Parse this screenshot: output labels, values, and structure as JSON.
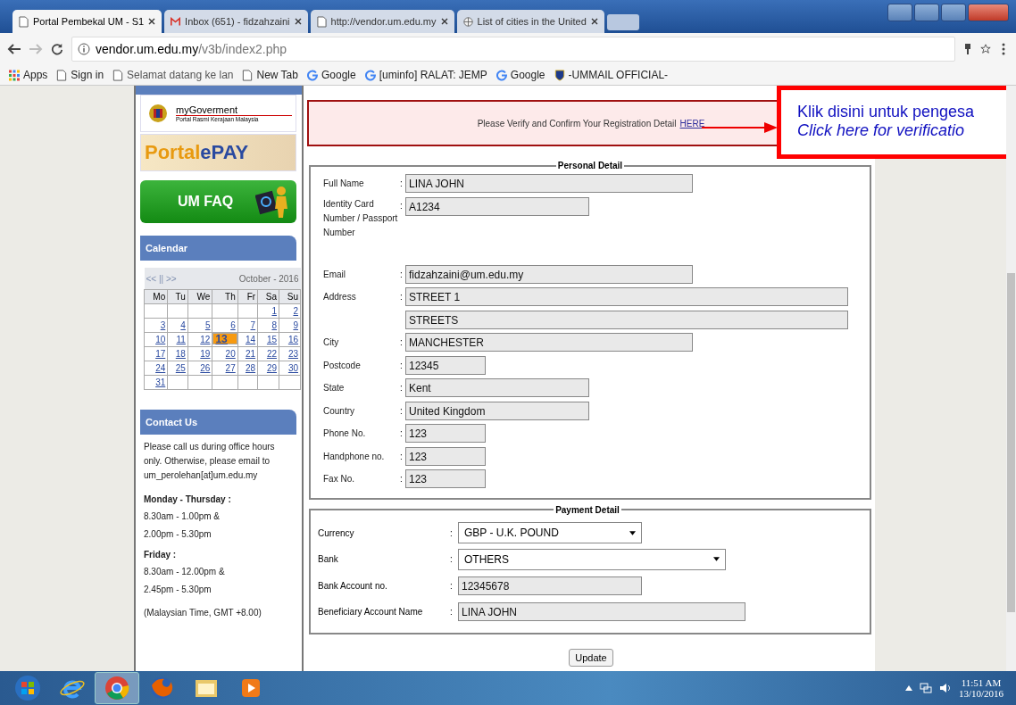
{
  "browser": {
    "tabs": [
      {
        "title": "Portal Pembekal UM - S1",
        "kind": "page",
        "selected": true
      },
      {
        "title": "Inbox (651) - fidzahzaini",
        "kind": "mail",
        "selected": false
      },
      {
        "title": "http://vendor.um.edu.my",
        "kind": "page",
        "selected": false
      },
      {
        "title": "List of cities in the United",
        "kind": "wiki",
        "selected": false
      }
    ],
    "address": {
      "host": "vendor.um.edu.my",
      "path": "/v3b/index2.php"
    },
    "bookmarks": [
      {
        "label": "Apps",
        "kind": "apps"
      },
      {
        "label": "Sign in",
        "kind": "page"
      },
      {
        "label": "Selamat datang ke lan",
        "kind": "page"
      },
      {
        "label": "New Tab",
        "kind": "page"
      },
      {
        "label": "Google",
        "kind": "google"
      },
      {
        "label": "[uminfo] RALAT: JEMP",
        "kind": "google"
      },
      {
        "label": "Google",
        "kind": "google"
      },
      {
        "label": "-UMMAIL OFFICIAL-",
        "kind": "shield"
      }
    ]
  },
  "sidebar": {
    "mygov": {
      "title": "myGoverment",
      "subtitle": "Portal Rasmi Kerajaan Malaysia"
    },
    "epay": {
      "part1": "Portal",
      "part2": "ePAY"
    },
    "faq": "UM FAQ",
    "calendar": {
      "title": "Calendar",
      "nav": "<< || >>",
      "month": "October - 2016",
      "weekdays": [
        "Mo",
        "Tu",
        "We",
        "Th",
        "Fr",
        "Sa",
        "Su"
      ],
      "weeks": [
        [
          {
            "day": "1",
            "selected": false
          },
          {
            "day": "2",
            "selected": false
          }
        ],
        [
          {
            "day": "3",
            "selected": false
          },
          {
            "day": "4",
            "selected": false
          },
          {
            "day": "5",
            "selected": false
          },
          {
            "day": "6",
            "selected": false
          },
          {
            "day": "7",
            "selected": false
          },
          {
            "day": "8",
            "selected": false
          },
          {
            "day": "9",
            "selected": false
          }
        ],
        [
          {
            "day": "10",
            "selected": false
          },
          {
            "day": "11",
            "selected": false
          },
          {
            "day": "12",
            "selected": false
          },
          {
            "day": "13",
            "selected": true
          },
          {
            "day": "14",
            "selected": false
          },
          {
            "day": "15",
            "selected": false
          },
          {
            "day": "16",
            "selected": false
          }
        ],
        [
          {
            "day": "17",
            "selected": false
          },
          {
            "day": "18",
            "selected": false
          },
          {
            "day": "19",
            "selected": false
          },
          {
            "day": "20",
            "selected": false
          },
          {
            "day": "21",
            "selected": false
          },
          {
            "day": "22",
            "selected": false
          },
          {
            "day": "23",
            "selected": false
          }
        ],
        [
          {
            "day": "24",
            "selected": false
          },
          {
            "day": "25",
            "selected": false
          },
          {
            "day": "26",
            "selected": false
          },
          {
            "day": "27",
            "selected": false
          },
          {
            "day": "28",
            "selected": false
          },
          {
            "day": "29",
            "selected": false
          },
          {
            "day": "30",
            "selected": false
          }
        ],
        [
          {
            "day": "31",
            "selected": false
          }
        ]
      ]
    },
    "contact": {
      "title": "Contact Us",
      "intro": "Please call us during office hours only. Otherwise, please email to um_perolehan[at]um.edu.my",
      "schedule": [
        {
          "heading": "Monday - Thursday :",
          "lines": [
            "8.30am - 1.00pm &",
            "2.00pm - 5.30pm"
          ]
        },
        {
          "heading": "Friday :",
          "lines": [
            "8.30am - 12.00pm &",
            "2.45pm - 5.30pm"
          ]
        }
      ],
      "note": "(Malaysian Time, GMT +8.00)"
    }
  },
  "notice": {
    "text": "Please Verify and Confirm Your Registration Detail",
    "link": "HERE"
  },
  "callout": {
    "line1": "Klik disini untuk pengesa",
    "line2": "Click here for verificatio"
  },
  "personal": {
    "legend": "Personal Detail",
    "fields": [
      {
        "label": "Full Name",
        "colon": ":",
        "value": "LINA JOHN",
        "kind": "long"
      },
      {
        "label": "Identity Card Number / Passport Number",
        "colon": ":",
        "value": "A1234",
        "kind": "medium"
      },
      {
        "label": "Email",
        "colon": ":",
        "value": "fidzahzaini@um.edu.my",
        "kind": "long"
      },
      {
        "label": "Address",
        "colon": ":",
        "value": "STREET 1",
        "kind": "wide"
      },
      {
        "value": "STREETS",
        "kind": "wide"
      },
      {
        "label": "City",
        "colon": ":",
        "value": "MANCHESTER",
        "kind": "long"
      },
      {
        "label": "Postcode",
        "colon": ":",
        "value": "12345",
        "kind": "short"
      },
      {
        "label": "State",
        "colon": ":",
        "value": "Kent",
        "kind": "medium"
      },
      {
        "label": "Country",
        "colon": ":",
        "value": "United Kingdom",
        "kind": "medium"
      },
      {
        "label": "Phone No.",
        "colon": ":",
        "value": "123",
        "kind": "short"
      },
      {
        "label": "Handphone no.",
        "colon": ":",
        "value": "123",
        "kind": "short"
      },
      {
        "label": "Fax No.",
        "colon": ":",
        "value": "123",
        "kind": "short"
      }
    ]
  },
  "payment": {
    "legend": "Payment Detail",
    "fields": [
      {
        "label": "Currency",
        "colon": ":",
        "value": "GBP - U.K. POUND",
        "kind": "select_medium"
      },
      {
        "label": "Bank",
        "colon": ":",
        "value": "OTHERS",
        "kind": "select_long"
      },
      {
        "label": "Bank Account no.",
        "colon": ":",
        "value": "12345678",
        "kind": "text_medium"
      },
      {
        "label": "Beneficiary Account Name",
        "colon": ":",
        "value": "LINA JOHN",
        "kind": "text_long"
      }
    ]
  },
  "update_button": "Update",
  "taskbar": {
    "apps": [
      {
        "kind": "start",
        "active": false
      },
      {
        "kind": "ie",
        "active": false
      },
      {
        "kind": "chrome",
        "active": true
      },
      {
        "kind": "firefox",
        "active": false
      },
      {
        "kind": "folder",
        "active": false
      },
      {
        "kind": "player",
        "active": false
      }
    ],
    "time": "11:51 AM",
    "date": "13/10/2016"
  }
}
